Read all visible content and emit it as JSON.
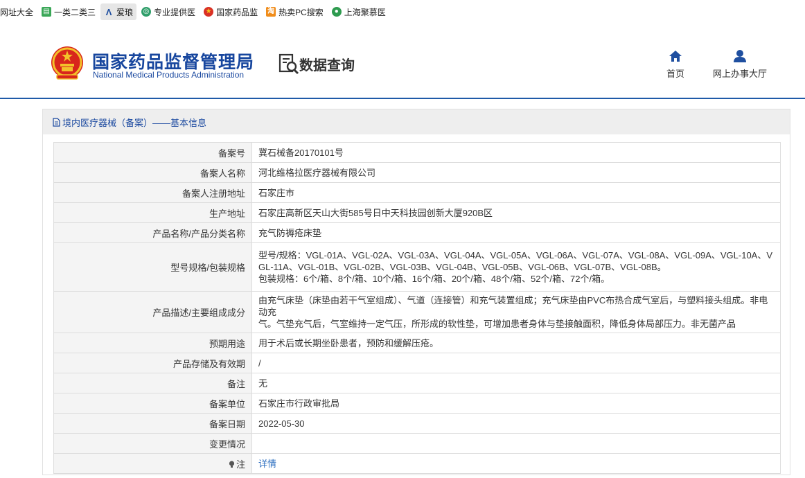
{
  "bookmarks": [
    {
      "label": "网址大全",
      "icon": "none"
    },
    {
      "label": "一类二类三",
      "icon": "doc-green-icon"
    },
    {
      "label": "爱琅",
      "icon": "letter-a-icon"
    },
    {
      "label": "专业提供医",
      "icon": "globe-green-icon"
    },
    {
      "label": "国家药品监",
      "icon": "emblem-icon"
    },
    {
      "label": "热卖PC搜索",
      "icon": "shop-orange-icon"
    },
    {
      "label": "上海聚慕医",
      "icon": "circle-green-icon"
    }
  ],
  "header": {
    "logo_cn": "国家药品监督管理局",
    "logo_en": "National Medical Products Administration",
    "section_title": "数据查询",
    "nav": [
      {
        "label": "首页",
        "icon": "home-icon"
      },
      {
        "label": "网上办事大厅",
        "icon": "user-icon"
      }
    ]
  },
  "panel": {
    "title": "境内医疗器械（备案）——基本信息"
  },
  "record": {
    "rows": [
      {
        "label": "备案号",
        "value": [
          "冀石械备20170101号"
        ]
      },
      {
        "label": "备案人名称",
        "value": [
          "河北维格拉医疗器械有限公司"
        ]
      },
      {
        "label": "备案人注册地址",
        "value": [
          "石家庄市"
        ]
      },
      {
        "label": "生产地址",
        "value": [
          "石家庄高新区天山大街585号日中天科技园创新大厦920B区"
        ]
      },
      {
        "label": "产品名称/产品分类名称",
        "value": [
          "充气防褥疮床垫"
        ]
      },
      {
        "label": "型号规格/包装规格",
        "value": [
          "型号/规格：VGL-01A、VGL-02A、VGL-03A、VGL-04A、VGL-05A、VGL-06A、VGL-07A、VGL-08A、VGL-09A、VGL-10A、V",
          "GL-11A、VGL-01B、VGL-02B、VGL-03B、VGL-04B、VGL-05B、VGL-06B、VGL-07B、VGL-08B。",
          "包装规格：6个/箱、8个/箱、10个/箱、16个/箱、20个/箱、48个/箱、52个/箱、72个/箱。"
        ]
      },
      {
        "label": "产品描述/主要组成成分",
        "value": [
          "由充气床垫（床垫由若干气室组成）、气道（连接管）和充气装置组成；充气床垫由PVC布热合成气室后，与塑料接头组成。非电动充",
          "气。气垫充气后，气室维持一定气压，所形成的软性垫，可增加患者身体与垫接触面积，降低身体局部压力。非无菌产品"
        ]
      },
      {
        "label": "预期用途",
        "value": [
          "用于术后或长期坐卧患者，预防和缓解压疮。"
        ]
      },
      {
        "label": "产品存储及有效期",
        "value": [
          "/"
        ]
      },
      {
        "label": "备注",
        "value": [
          "无"
        ]
      },
      {
        "label": "备案单位",
        "value": [
          "石家庄市行政审批局"
        ]
      },
      {
        "label": "备案日期",
        "value": [
          "2022-05-30"
        ]
      },
      {
        "label": "变更情况",
        "value": [
          ""
        ]
      }
    ],
    "note": {
      "label": "注",
      "link": "详情"
    }
  },
  "colors": {
    "brand_blue": "#17469e",
    "link_blue": "#2e6fc0",
    "header_line": "#1f5aa8"
  }
}
